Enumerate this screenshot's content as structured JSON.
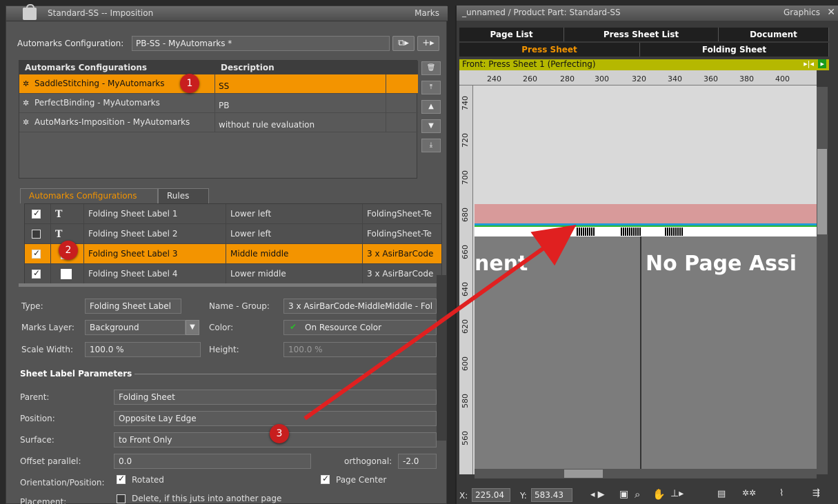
{
  "left": {
    "title": "Standard-SS -- Imposition",
    "title_right": "Marks",
    "config_label": "Automarks Configuration:",
    "config_value": "PB-SS - MyAutomarks *",
    "table_headers": [
      "Automarks Configurations",
      "Description"
    ],
    "configs": [
      {
        "name": "SaddleStitching - MyAutomarks",
        "desc": "SS"
      },
      {
        "name": "PerfectBinding - MyAutomarks",
        "desc": "PB"
      },
      {
        "name": "AutoMarks-Imposition - MyAutomarks",
        "desc": "without rule evaluation"
      }
    ],
    "tabs": [
      "Automarks Configurations",
      "Rules"
    ],
    "rules": [
      {
        "checked": true,
        "glyph": "T",
        "name": "Folding Sheet Label 1",
        "pos": "Lower left",
        "res": "FoldingSheet-Te"
      },
      {
        "checked": false,
        "glyph": "T",
        "name": "Folding Sheet Label 2",
        "pos": "Lower left",
        "res": "FoldingSheet-Te"
      },
      {
        "checked": true,
        "glyph": "",
        "name": "Folding Sheet Label 3",
        "pos": "Middle middle",
        "res": "3 x AsirBarCode"
      },
      {
        "checked": true,
        "glyph": "",
        "name": "Folding Sheet Label 4",
        "pos": "Lower middle",
        "res": "3 x AsirBarCode"
      }
    ],
    "props": {
      "type_label": "Type:",
      "type_value": "Folding Sheet Label",
      "name_label": "Name - Group:",
      "name_value": "3 x AsirBarCode-MiddleMiddle - Fol",
      "layer_label": "Marks Layer:",
      "layer_value": "Background",
      "color_label": "Color:",
      "color_value": "On Resource Color",
      "scale_label": "Scale Width:",
      "scale_value": "100.0 %",
      "height_label": "Height:",
      "height_value": "100.0 %",
      "section": "Sheet Label Parameters",
      "parent_label": "Parent:",
      "parent_value": "Folding Sheet",
      "position_label": "Position:",
      "position_value": "Opposite Lay Edge",
      "surface_label": "Surface:",
      "surface_value": "to Front Only",
      "offset_label": "Offset parallel:",
      "offset_value": "0.0",
      "orth_label": "orthogonal:",
      "orth_value": "-2.0",
      "orient_label": "Orientation/Position:",
      "rotated_label": "Rotated",
      "pagecenter_label": "Page Center",
      "placement_label": "Placement:",
      "delete_label": "Delete, if this juts into another page"
    }
  },
  "right": {
    "title": "_unnamed / Product Part: Standard-SS",
    "title_right": "Graphics",
    "tabs_row1": [
      "Page List",
      "Press Sheet List",
      "Document"
    ],
    "tabs_row2": [
      "Press Sheet",
      "Folding Sheet"
    ],
    "front_label": "Front:  Press Sheet 1 (Perfecting)",
    "ruler_h": [
      "240",
      "260",
      "280",
      "300",
      "320",
      "340",
      "360",
      "380",
      "400"
    ],
    "ruler_v": [
      "740",
      "720",
      "700",
      "680",
      "660",
      "640",
      "620",
      "600",
      "580",
      "560"
    ],
    "page_left_text": "nent",
    "page_right_text": "No Page Assi",
    "x_label": "X:",
    "x_value": "225.04",
    "y_label": "Y:",
    "y_value": "583.43"
  },
  "badges": [
    "1",
    "2",
    "3"
  ],
  "colors": {
    "accent": "#f39400",
    "badge": "#c81e1e",
    "arrow": "#e02020",
    "front_bar": "#b5b800",
    "pink_band": "#d89a9a"
  }
}
